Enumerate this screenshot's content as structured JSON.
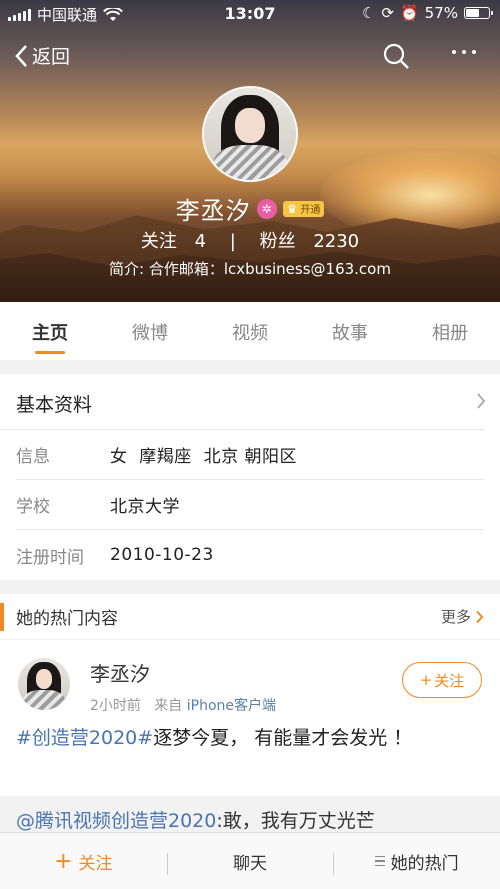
{
  "status_bar": {
    "carrier": "中国联通",
    "time": "13:07",
    "battery": "57%",
    "battery_level": 0.57
  },
  "nav": {
    "back_label": "返回"
  },
  "profile": {
    "name": "李丞汐",
    "member_label": "开通",
    "follow_label": "关注",
    "follow_count": "4",
    "fans_label": "粉丝",
    "fans_count": "2230",
    "separator": "|",
    "bio": "简介: 合作邮箱：lcxbusiness@163.com"
  },
  "tabs": [
    {
      "label": "主页",
      "active": true
    },
    {
      "label": "微博",
      "active": false
    },
    {
      "label": "视频",
      "active": false
    },
    {
      "label": "故事",
      "active": false
    },
    {
      "label": "相册",
      "active": false
    }
  ],
  "basic_info": {
    "title": "基本资料",
    "rows": [
      {
        "key": "信息",
        "value": "女  摩羯座  北京 朝阳区"
      },
      {
        "key": "学校",
        "value": "北京大学"
      },
      {
        "key": "注册时间",
        "value": "2010-10-23"
      }
    ]
  },
  "hot": {
    "title": "她的热门内容",
    "more_label": "更多",
    "post": {
      "author": "李丞汐",
      "time": "2小时前",
      "from": "来自",
      "source": "iPhone客户端",
      "follow_label": "关注",
      "hashtag": "#创造营2020#",
      "text": "逐梦今夏， 有能量才会发光 ！",
      "repost_at": "@腾讯视频创造营2020",
      "repost_text": ":敢，我有万丈光芒"
    }
  },
  "bottom_bar": {
    "follow": "关注",
    "chat": "聊天",
    "hot": "她的热门"
  }
}
